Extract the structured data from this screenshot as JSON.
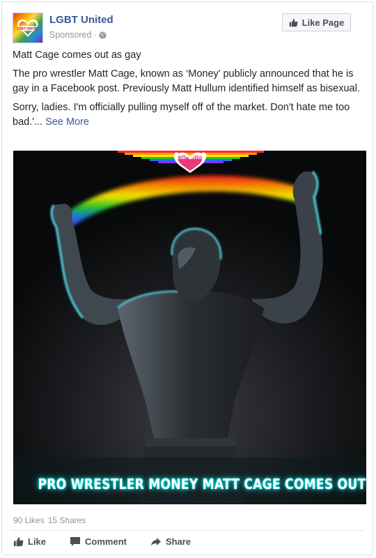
{
  "page": {
    "name": "LGBT United",
    "sponsored_label": "Sponsored",
    "separator": "·",
    "avatar_text": "LGBT UNITED"
  },
  "like_page_button": {
    "label": "Like Page"
  },
  "post": {
    "headline": "Matt Cage comes out as gay",
    "paragraph": "The pro wrestler Matt Cage, known as ‘Money’ publicly announced that he is gay in a Facebook post. Previously Matt Hullum identified himself as bisexual.",
    "quote": "Sorry, ladies. I'm officially pulling myself off of the market. Don't hate me too bad.'...",
    "see_more": "See More"
  },
  "image": {
    "caption": "PRO WRESTLER MONEY MATT CAGE COMES OUT AS GAY",
    "badge_text": "LGBT UNITED"
  },
  "engagement": {
    "likes": "90 Likes",
    "shares": "15 Shares"
  },
  "actions": {
    "like": "Like",
    "comment": "Comment",
    "share": "Share"
  },
  "icons": {
    "globe": "globe-icon",
    "thumbs_up": "thumbs-up-icon",
    "comment": "comment-icon",
    "share": "share-icon"
  },
  "colors": {
    "link": "#365899",
    "muted": "#90949c",
    "text": "#1d2129",
    "button_text": "#4b4f56"
  }
}
